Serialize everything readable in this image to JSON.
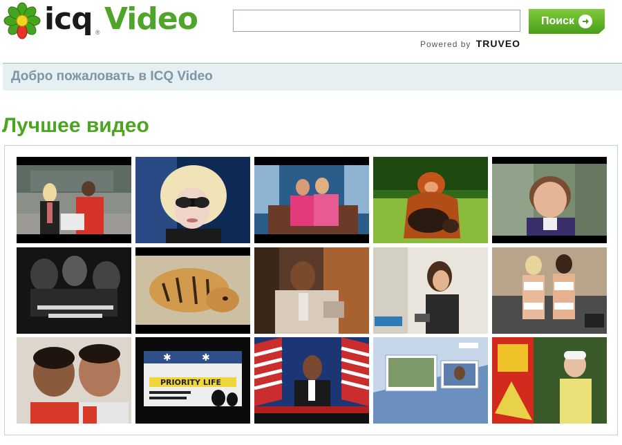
{
  "logo": {
    "icq": "icq",
    "video": "Video",
    "reg": "®"
  },
  "search": {
    "value": "",
    "placeholder": "",
    "button_label": "Поиск"
  },
  "powered": {
    "prefix": "Powered by",
    "brand": "TRUVEO"
  },
  "welcome": {
    "text": "Добро пожаловать в ICQ Video"
  },
  "section": {
    "title": "Лучшее видео"
  },
  "colors": {
    "accent_green": "#4aa51f",
    "welcome_bg": "#e6eff1",
    "welcome_text": "#7c95a8"
  },
  "thumbnails": [
    {
      "name": "thumb-two-people-tv-set",
      "overlay": ""
    },
    {
      "name": "thumb-blonde-sunglasses",
      "overlay": ""
    },
    {
      "name": "thumb-couple-pink-outfits",
      "overlay": ""
    },
    {
      "name": "thumb-orangutan-with-dog",
      "overlay": ""
    },
    {
      "name": "thumb-elderly-woman",
      "overlay": ""
    },
    {
      "name": "thumb-dark-movie-scene",
      "overlay": ""
    },
    {
      "name": "thumb-tiger-cub",
      "overlay": ""
    },
    {
      "name": "thumb-man-interview",
      "overlay": ""
    },
    {
      "name": "thumb-woman-red-carpet",
      "overlay": ""
    },
    {
      "name": "thumb-two-women-stage",
      "overlay": ""
    },
    {
      "name": "thumb-two-men-smiling",
      "overlay": ""
    },
    {
      "name": "thumb-priority-life-bus",
      "overlay": "PRIORITY LIFE"
    },
    {
      "name": "thumb-politician-podium",
      "overlay": ""
    },
    {
      "name": "thumb-news-graphics",
      "overlay": ""
    },
    {
      "name": "thumb-woman-with-flag",
      "overlay": ""
    }
  ]
}
